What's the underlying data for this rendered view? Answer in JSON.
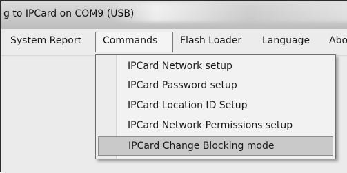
{
  "window": {
    "title": "g to IPCard on COM9 (USB)"
  },
  "menubar": {
    "items": [
      {
        "label": "System Report"
      },
      {
        "label": "Commands",
        "active": true
      },
      {
        "label": "Flash Loader"
      },
      {
        "label": "Language"
      },
      {
        "label": "Abo"
      }
    ]
  },
  "commands_menu": {
    "items": [
      {
        "label": "IPCard Network setup"
      },
      {
        "label": "IPCard Password setup"
      },
      {
        "label": "IPCard Location ID Setup"
      },
      {
        "label": "IPCard Network Permissions setup"
      },
      {
        "label": "IPCard Change Blocking mode",
        "highlighted": true
      }
    ]
  }
}
